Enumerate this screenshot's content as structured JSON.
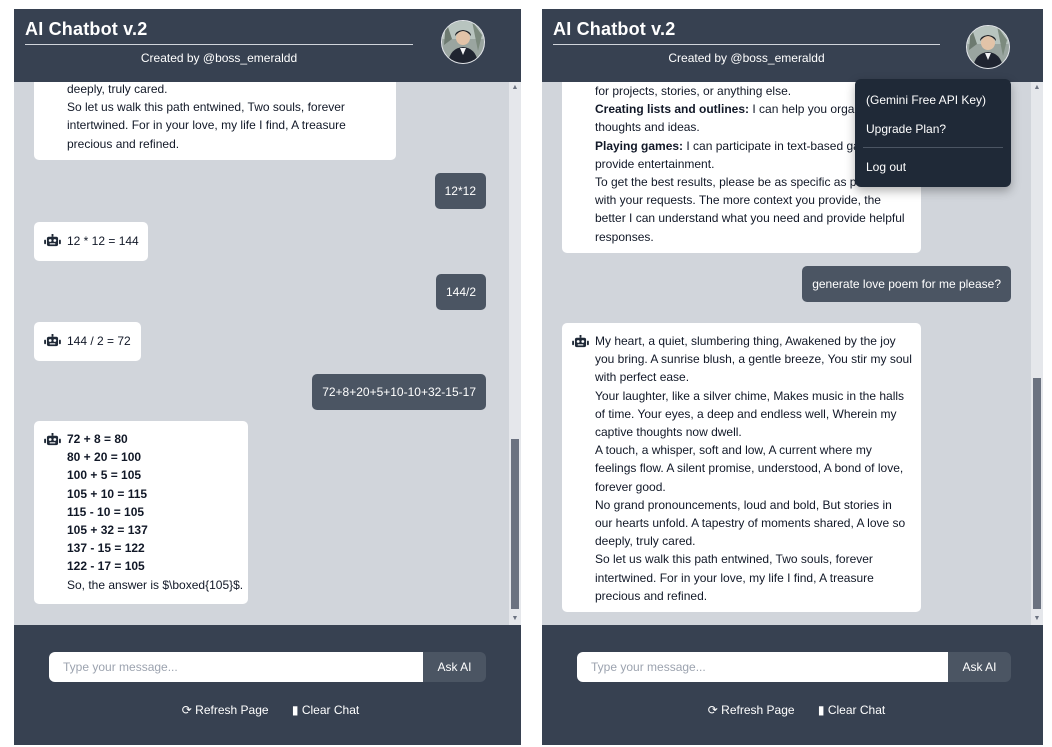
{
  "app": {
    "title": "AI Chatbot v.2",
    "subtitle": "Created by @boss_emeraldd"
  },
  "footer": {
    "input_placeholder": "Type your message...",
    "ask_label": "Ask AI",
    "refresh_label": "Refresh Page",
    "clear_label": "Clear Chat",
    "refresh_icon": "refresh-icon",
    "clear_icon": "trash-icon"
  },
  "left_panel": {
    "poem_tail": [
      "deeply, truly cared.",
      "So let us walk this path entwined, Two souls, forever",
      "intertwined. For in your love, my life I find, A treasure",
      "precious and refined."
    ],
    "user_1": "12*12",
    "bot_1": "12 * 12 = 144",
    "user_2": "144/2",
    "bot_2": "144 / 2 = 72",
    "user_3": "72+8+20+5+10-10+32-15-17",
    "bot_3_lines": [
      "72 + 8 = 80",
      "80 + 20 = 100",
      "100 + 5 = 105",
      "105 + 10 = 115",
      "115 - 10 = 105",
      "105 + 32 = 137",
      "137 - 15 = 122",
      "122 - 17 = 105"
    ],
    "bot_3_answer": "So, the answer is $\\boxed{105}$."
  },
  "right_panel": {
    "prev_bot": {
      "line_1": "for projects, stories, or anything else.",
      "lists_bold": "Creating lists and outlines:",
      "lists_text": "I can help you organize your",
      "line_3": "thoughts and ideas.",
      "games_bold": "Playing games:",
      "games_text": "I can participate in text-based games and",
      "line_5": "provide entertainment.",
      "line_6": "To get the best results, please be as specific as possible",
      "line_7": "with your requests. The more context you provide, the",
      "line_8": "better I can understand what you need and provide helpful",
      "line_9": "responses."
    },
    "user_msg": "generate love poem for me please?",
    "poem_lines": [
      "My heart, a quiet, slumbering thing, Awakened by the joy",
      "you bring. A sunrise blush, a gentle breeze, You stir my soul",
      "with perfect ease.",
      "Your laughter, like a silver chime, Makes music in the halls",
      "of time. Your eyes, a deep and endless well, Wherein my",
      "captive thoughts now dwell.",
      "A touch, a whisper, soft and low, A current where my",
      "feelings flow. A silent promise, understood, A bond of love,",
      "forever good.",
      "No grand pronouncements, loud and bold, But stories in",
      "our hearts unfold. A tapestry of moments shared, A love so",
      "deeply, truly cared.",
      "So let us walk this path entwined, Two souls, forever",
      "intertwined. For in your love, my life I find, A treasure",
      "precious and refined."
    ],
    "menu": {
      "item_1": "(Gemini Free API Key)",
      "item_2": "Upgrade Plan?",
      "item_3": "Log out"
    }
  },
  "colors": {
    "header_bg": "#374151",
    "chat_bg": "#d1d5db",
    "user_bubble": "#4b5563",
    "menu_bg": "#1f2937"
  }
}
